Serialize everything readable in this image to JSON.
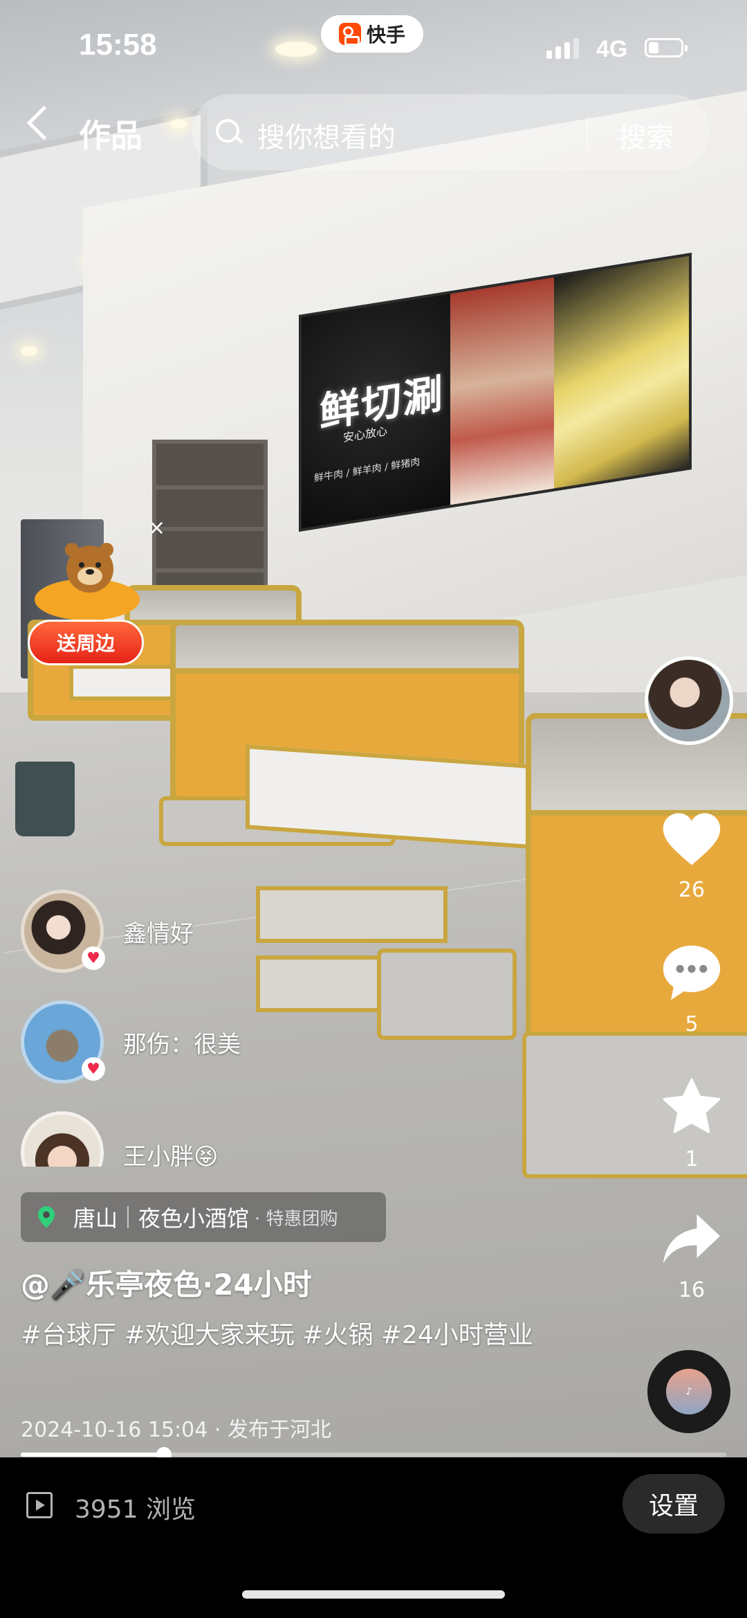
{
  "status_bar": {
    "time": "15:58",
    "app_name": "快手",
    "network": "4G"
  },
  "nav": {
    "title": "作品",
    "search_placeholder": "搜你想看的",
    "search_button": "搜索"
  },
  "background_sign": {
    "title": "鲜切涮",
    "subtitle": "安心放心",
    "footer": "鲜牛肉 / 鲜羊肉 / 鲜猪肉"
  },
  "promo": {
    "close": "×",
    "label": "送周边"
  },
  "fans": [
    {
      "text": "鑫情好"
    },
    {
      "text": "那伤：很美"
    },
    {
      "text": "王小胖😝"
    }
  ],
  "actions": {
    "likes": "26",
    "comments": "5",
    "favorites": "1",
    "shares": "16"
  },
  "location": {
    "city": "唐山",
    "shop": "夜色小酒馆",
    "tag": "· 特惠团购"
  },
  "post": {
    "author": "@🎤乐亭夜色·24小时",
    "hashtags": "#台球厅 #欢迎大家来玩 #火锅 #24小时营业",
    "meta": "2024-10-16 15:04 · 发布于河北"
  },
  "playback": {
    "progress": 0.203
  },
  "bottom_bar": {
    "views": "3951 浏览",
    "settings_label": "设置"
  },
  "colors": {
    "like": "#ffffff",
    "badge_heart": "#f02a4a",
    "promo": "#e62117",
    "pin": "#2fd07a"
  }
}
